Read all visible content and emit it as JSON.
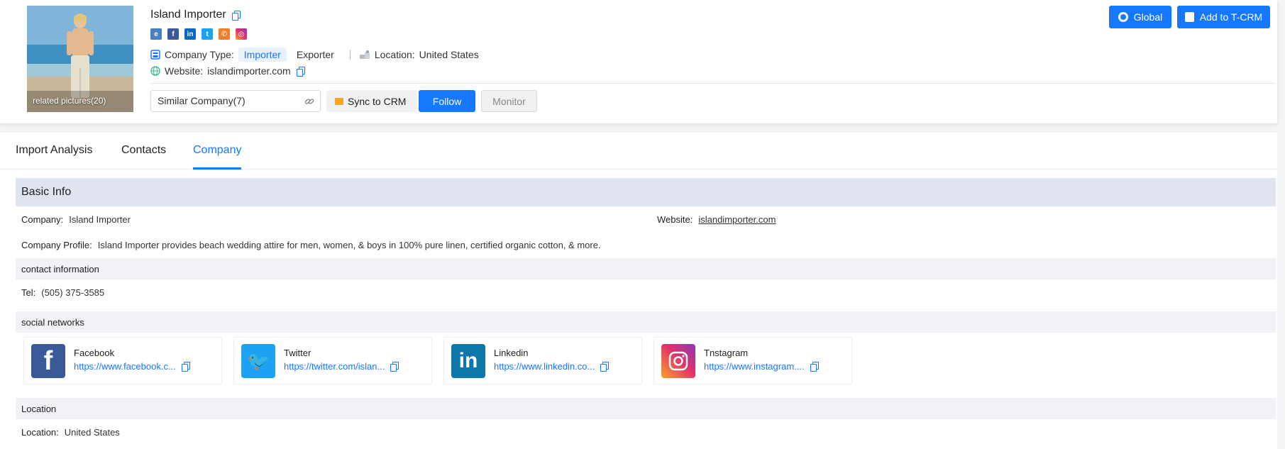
{
  "header": {
    "thumbnail_caption": "related pictures(20)",
    "company_name": "Island Importer",
    "social_icons": [
      "web-icon",
      "facebook-icon",
      "linkedin-icon",
      "twitter-icon",
      "phone-icon",
      "instagram-icon"
    ],
    "company_type_label": "Company Type:",
    "types": [
      "Importer",
      "Exporter"
    ],
    "location_label": "Location:",
    "location_value": "United States",
    "website_label": "Website:",
    "website_value": "islandimporter.com",
    "similar_company": "Similar Company(7)",
    "sync_crm": "Sync to CRM",
    "follow": "Follow",
    "monitor": "Monitor",
    "global": "Global",
    "add_tcrm": "Add to T-CRM"
  },
  "tabs": [
    "Import Analysis",
    "Contacts",
    "Company"
  ],
  "active_tab": "Company",
  "basic_info": {
    "title": "Basic Info",
    "company_label": "Company:",
    "company_value": "Island Importer",
    "website_label": "Website:",
    "website_value": "islandimporter.com",
    "profile_label": "Company Profile:",
    "profile_value": "Island Importer provides beach wedding attire for men, women, & boys in 100% pure linen, certified organic cotton, & more."
  },
  "contact": {
    "title": "contact information",
    "tel_label": "Tel:",
    "tel_value": "(505) 375-3585"
  },
  "social": {
    "title": "social networks",
    "cards": [
      {
        "name": "Facebook",
        "url": "https://www.facebook.c...",
        "icon": "facebook-icon"
      },
      {
        "name": "Twitter",
        "url": "https://twitter.com/islan...",
        "icon": "twitter-icon"
      },
      {
        "name": "Linkedin",
        "url": "https://www.linkedin.co...",
        "icon": "linkedin-icon"
      },
      {
        "name": "Tnstagram",
        "url": "https://www.instagram....",
        "icon": "instagram-icon"
      }
    ]
  },
  "location": {
    "title": "Location",
    "label": "Location:",
    "value": "United States"
  },
  "colors": {
    "primary": "#1677ff",
    "section_bg": "#dfe4ef",
    "subsection_bg": "#f0f2f6"
  }
}
